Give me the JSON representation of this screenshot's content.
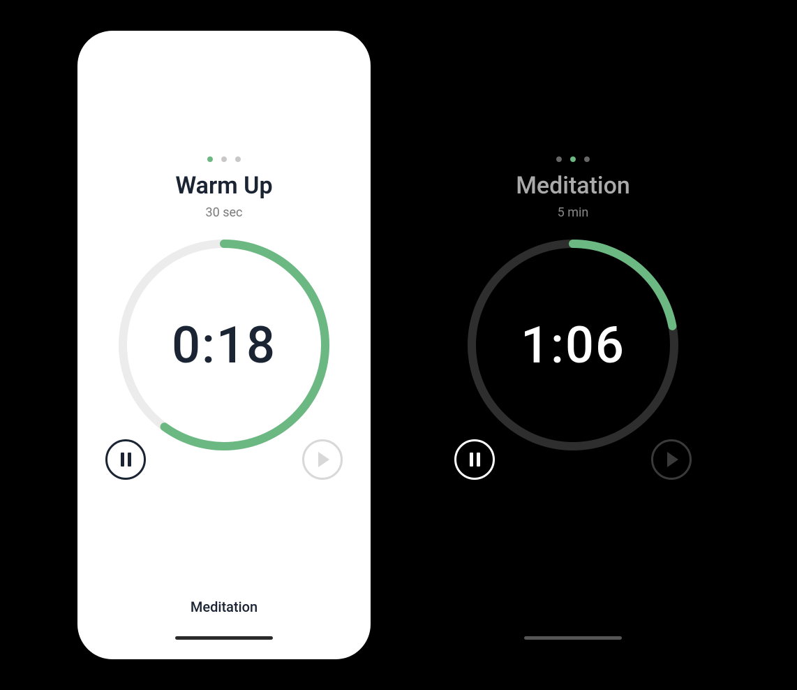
{
  "light": {
    "pageDots": {
      "count": 3,
      "activeIndex": 0
    },
    "title": "Warm Up",
    "subtitle": "30 sec",
    "time": "0:18",
    "progress": 0.6,
    "nextLabel": "Meditation",
    "accent": "#6cb882",
    "trackColor": "#ececec"
  },
  "dark": {
    "pageDots": {
      "count": 3,
      "activeIndex": 1
    },
    "title": "Meditation",
    "subtitle": "5 min",
    "time": "1:06",
    "progress": 0.22,
    "accent": "#6cb882",
    "trackColor": "#2e2e2e"
  },
  "icons": {
    "pause": "pause-icon",
    "play": "play-icon"
  }
}
